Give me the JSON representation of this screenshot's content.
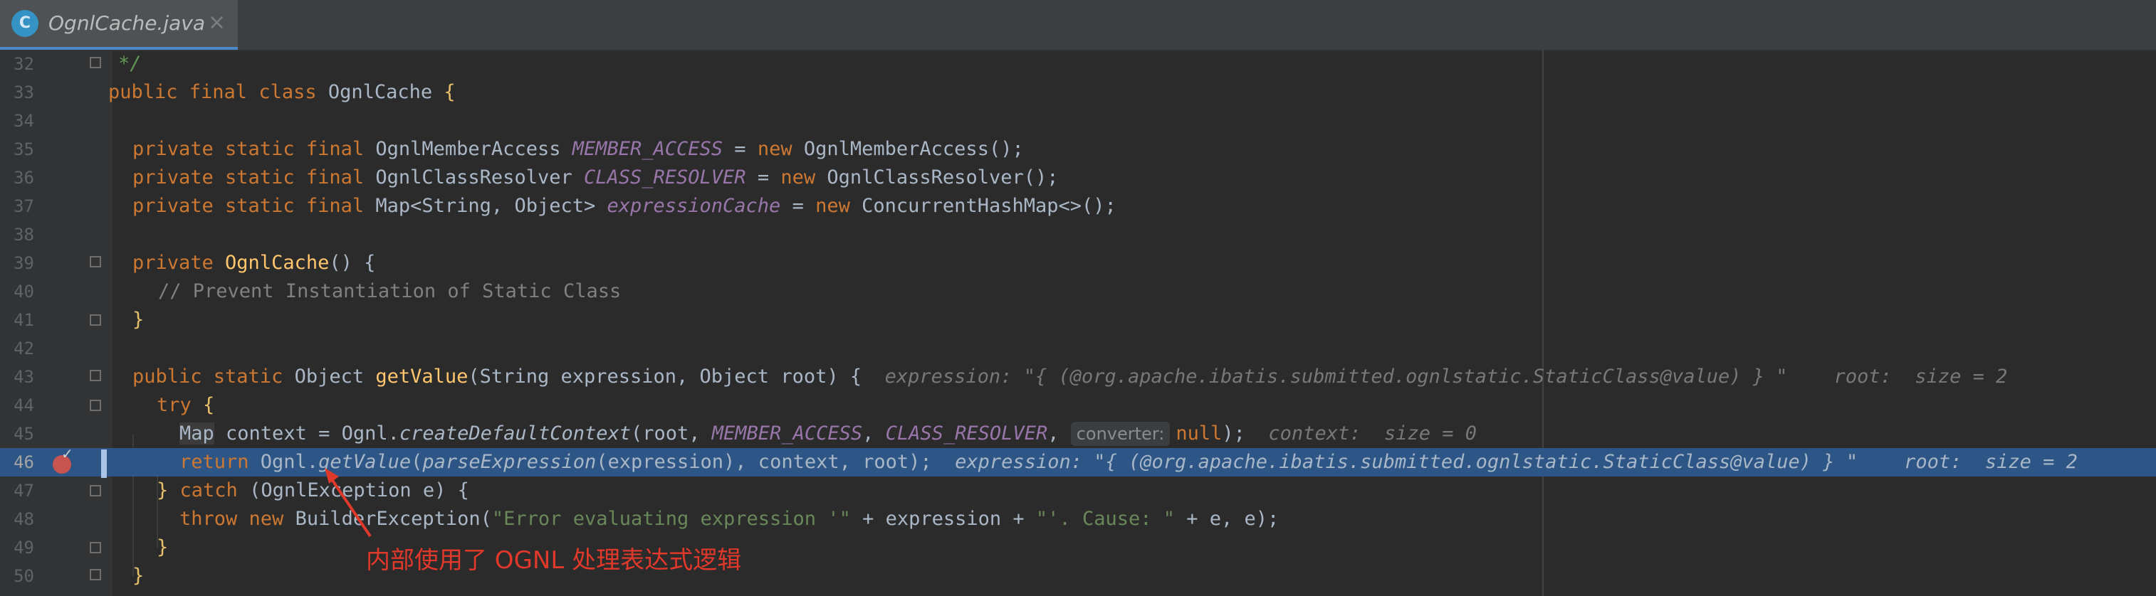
{
  "tab": {
    "icon_letter": "C",
    "filename": "OgnlCache.java",
    "close": "×"
  },
  "annotation": "内部使用了 OGNL 处理表达式逻辑",
  "colors": {
    "highlight": "#2d5585",
    "keyword": "#cc7832",
    "constant": "#9876aa",
    "string": "#6a8759",
    "annotation": "#e0392b",
    "breakpoint": "#c75450"
  },
  "line_numbers": [
    "32",
    "33",
    "34",
    "35",
    "36",
    "37",
    "38",
    "39",
    "40",
    "41",
    "42",
    "43",
    "44",
    "45",
    "46",
    "47",
    "48",
    "49",
    "50"
  ],
  "code": {
    "l32": {
      "text": "*/"
    },
    "l33": {
      "kw": "public final class ",
      "name": "OgnlCache",
      "brace": " {"
    },
    "l35": {
      "kw1": "private static final ",
      "type": "OgnlMemberAccess ",
      "const": "MEMBER_ACCESS",
      "eq": " = ",
      "kw2": "new ",
      "ctor": "OgnlMemberAccess",
      "rest": "();"
    },
    "l36": {
      "kw1": "private static final ",
      "type": "OgnlClassResolver ",
      "const": "CLASS_RESOLVER",
      "eq": " = ",
      "kw2": "new ",
      "ctor": "OgnlClassResolver",
      "rest": "();"
    },
    "l37": {
      "kw1": "private static final ",
      "type": "Map<String, Object> ",
      "const": "expressionCache",
      "eq": " = ",
      "kw2": "new ",
      "ctor": "ConcurrentHashMap<>",
      "rest": "();"
    },
    "l39": {
      "kw": "private ",
      "fn": "OgnlCache",
      "rest": "() {"
    },
    "l40": {
      "comment": "// Prevent Instantiation of Static Class"
    },
    "l41": {
      "brace": "}"
    },
    "l43": {
      "kw": "public static ",
      "type": "Object ",
      "fn": "getValue",
      "params": "(String expression, Object root) {",
      "hint": "expression: \"{ (@org.apache.ibatis.submitted.ognlstatic.StaticClass@value) } \"    root:  size = 2"
    },
    "l44": {
      "kw": "try",
      "brace": " {"
    },
    "l45": {
      "type": "Map",
      "mid": " context = Ognl.",
      "call": "createDefaultContext",
      "args": "(root, ",
      "c1": "MEMBER_ACCESS",
      "comma": ", ",
      "c2": "CLASS_RESOLVER",
      "comma2": ", ",
      "badge": "converter:",
      "kwnull": "null",
      "end": ");",
      "hint": "context:  size = 0"
    },
    "l46": {
      "kw": "return ",
      "obj": "Ognl.",
      "call": "getValue",
      "open": "(",
      "call2": "parseExpression",
      "args": "(expression), context, root);",
      "hint": "expression: \"{ (@org.apache.ibatis.submitted.ognlstatic.StaticClass@value) } \"    root:  size = 2"
    },
    "l47": {
      "brace": "} ",
      "kw": "catch ",
      "rest": "(OgnlException e) {"
    },
    "l48": {
      "kw": "throw new ",
      "type": "BuilderException(",
      "str1": "\"Error evaluating expression '\"",
      "mid": " + expression + ",
      "str2": "\"'. Cause: \"",
      "end": " + e, e);"
    },
    "l49": {
      "brace": "}"
    },
    "l50": {
      "brace": "}"
    }
  }
}
